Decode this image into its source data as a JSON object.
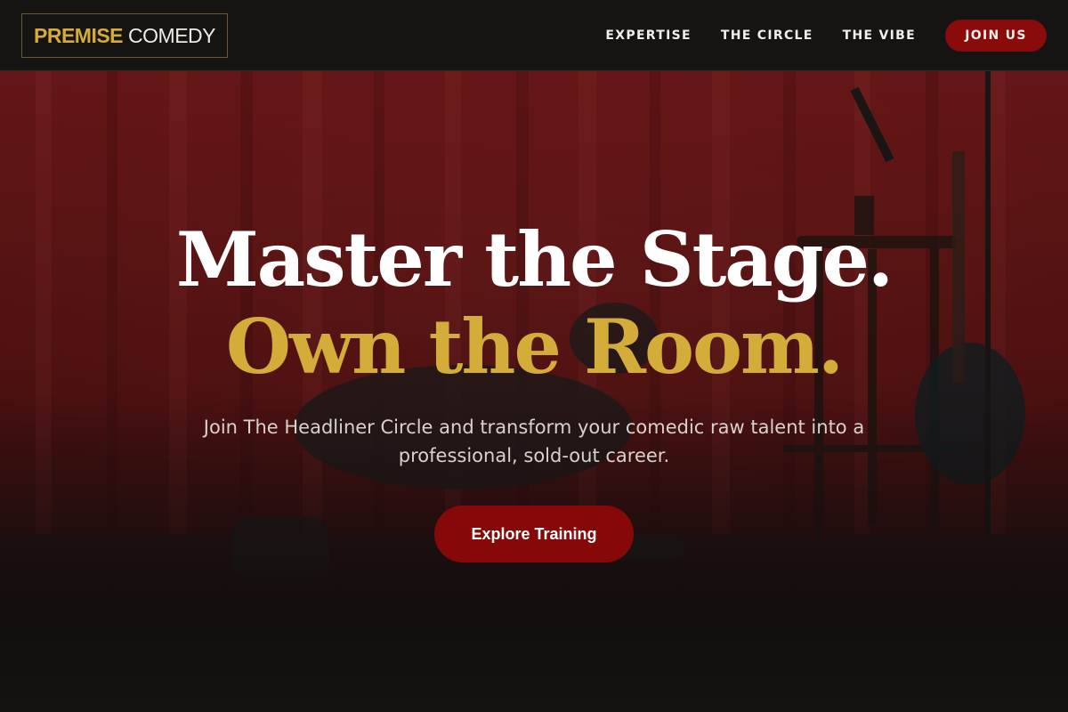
{
  "header": {
    "logo": {
      "brand": "PREMISE",
      "word": "COMEDY"
    },
    "nav": [
      {
        "label": "EXPERTISE"
      },
      {
        "label": "THE CIRCLE"
      },
      {
        "label": "THE VIBE"
      }
    ],
    "join_label": "JOIN US"
  },
  "hero": {
    "headline_line1": "Master the Stage.",
    "headline_line2": "Own the Room.",
    "subtitle": "Join The Headliner Circle and transform your comedic raw talent into a professional, sold-out career.",
    "cta_label": "Explore Training",
    "image": "comedian-on-stage-red-curtain"
  },
  "colors": {
    "accent_gold": "#d4ac3a",
    "brand_red": "#8a0b0b",
    "background": "#161313"
  }
}
